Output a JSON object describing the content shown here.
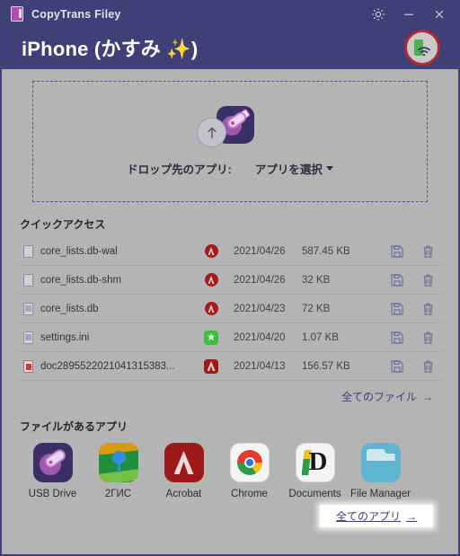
{
  "titlebar": {
    "app_name": "CopyTrans Filey",
    "logo_icon": "phone-app-logo-icon",
    "buttons": [
      {
        "name": "settings-button",
        "icon": "gear-icon",
        "label": ""
      },
      {
        "name": "minimize-button",
        "icon": "minimize-icon",
        "label": ""
      },
      {
        "name": "close-button",
        "icon": "close-icon",
        "label": ""
      }
    ]
  },
  "device_header": {
    "device_name": "iPhone",
    "device_label": "(かすみ ✨)",
    "connection_icon": "wifi-device-connected-icon"
  },
  "dropzone": {
    "app_icon": "usb-drive-icon",
    "upload_icon": "upload-arrow-icon",
    "label": "ドロップ先のアプリ:",
    "select_value": "アプリを選択",
    "caret_icon": "chevron-down-icon"
  },
  "quick_access": {
    "heading": "クイックアクセス",
    "files": [
      {
        "file_icon": "blank-document-icon",
        "name": "core_lists.db-wal",
        "app_icon": "acrobat-circle-badge-icon",
        "date": "2021/04/26",
        "size": "587.45 KB",
        "save_icon": "save-floppy-icon",
        "delete_icon": "trash-icon"
      },
      {
        "file_icon": "blank-document-icon",
        "name": "core_lists.db-shm",
        "app_icon": "acrobat-circle-badge-icon",
        "date": "2021/04/26",
        "size": "32 KB",
        "save_icon": "save-floppy-icon",
        "delete_icon": "trash-icon"
      },
      {
        "file_icon": "gray-document-icon",
        "name": "core_lists.db",
        "app_icon": "acrobat-circle-badge-icon",
        "date": "2021/04/23",
        "size": "72 KB",
        "save_icon": "save-floppy-icon",
        "delete_icon": "trash-icon"
      },
      {
        "file_icon": "blue-document-icon",
        "name": "settings.ini",
        "app_icon": "green-app-badge-icon",
        "date": "2021/04/20",
        "size": "1.07 KB",
        "save_icon": "save-floppy-icon",
        "delete_icon": "trash-icon"
      },
      {
        "file_icon": "pdf-document-icon",
        "name": "doc2895522021041315383...",
        "app_icon": "acrobat-square-badge-icon",
        "date": "2021/04/13",
        "size": "156.57 KB",
        "save_icon": "save-floppy-icon",
        "delete_icon": "trash-icon"
      }
    ],
    "all_files_link": "全てのファイル",
    "all_files_arrow": "→"
  },
  "apps_section": {
    "heading": "ファイルがあるアプリ",
    "apps": [
      {
        "label": "USB Drive",
        "icon": "usb-drive-app-icon"
      },
      {
        "label": "2ГИС",
        "icon": "2gis-app-icon"
      },
      {
        "label": "Acrobat",
        "icon": "acrobat-app-icon"
      },
      {
        "label": "Chrome",
        "icon": "chrome-app-icon"
      },
      {
        "label": "Documents",
        "icon": "documents-app-icon"
      },
      {
        "label": "File Manager",
        "icon": "file-manager-app-icon"
      }
    ],
    "all_apps_link": "全てのアプリ",
    "all_apps_arrow": "→"
  },
  "colors": {
    "header_bg": "#3f4077",
    "page_bg": "#b4b4b4",
    "link": "#3b3d78",
    "accent_red": "#b02a2f",
    "dropzone_border": "#51538c"
  }
}
